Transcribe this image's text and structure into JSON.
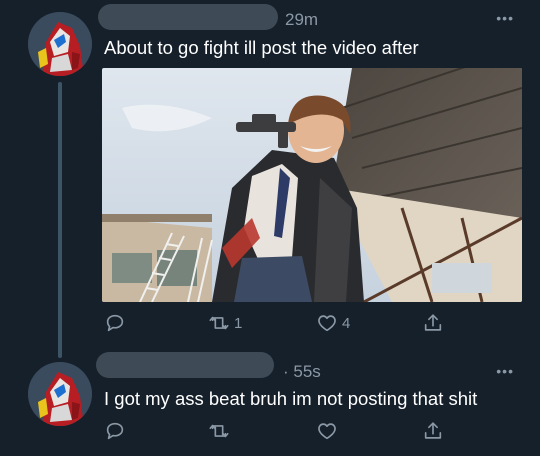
{
  "tweets": [
    {
      "time": "29m",
      "more": "•••",
      "text": "About to go fight ill post the video after",
      "replies": "",
      "retweets": "1",
      "likes": "4"
    },
    {
      "time": "· 55s",
      "more": "•••",
      "text": "I got my ass beat bruh im not posting that shit",
      "replies": "",
      "retweets": "",
      "likes": ""
    }
  ],
  "icons": {
    "reply": "reply-icon",
    "retweet": "retweet-icon",
    "like": "heart-icon",
    "share": "share-icon",
    "more": "more-icon"
  },
  "colors": {
    "background": "#15202b",
    "secondary_text": "#8b98a5",
    "thread_line": "#3d5466"
  }
}
